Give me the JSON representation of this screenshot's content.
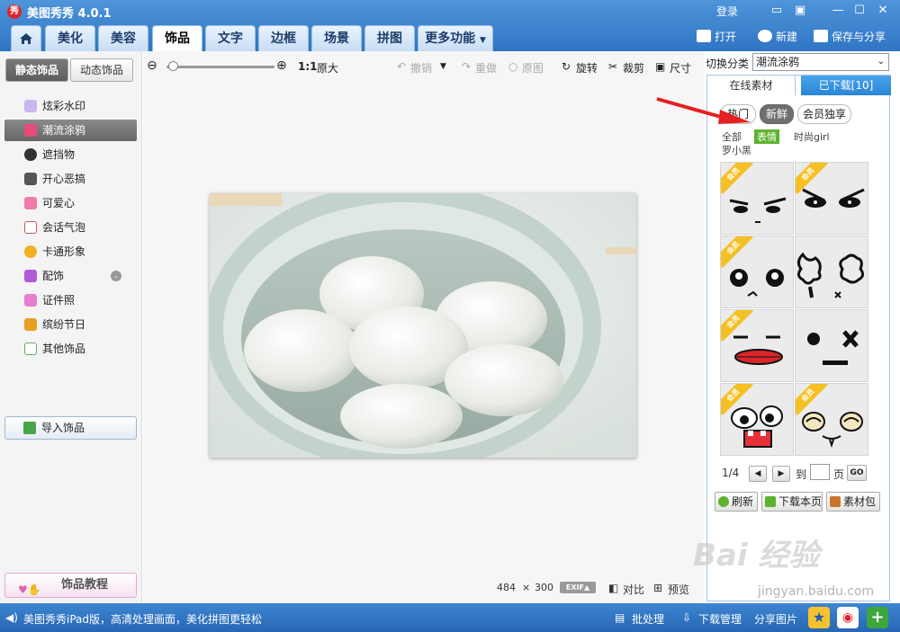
{
  "app": {
    "title": "美图秀秀 4.0.1",
    "logo_text": "秀",
    "login": "登录",
    "window_controls": [
      "chat-icon",
      "skin-icon",
      "minimize-icon",
      "maximize-icon",
      "close-icon"
    ]
  },
  "main_tabs": [
    "美化",
    "美容",
    "饰品",
    "文字",
    "边框",
    "场景",
    "拼图",
    "更多功能"
  ],
  "main_tab_active": "饰品",
  "top_actions": {
    "open": "打开",
    "new": "新建",
    "save_share": "保存与分享"
  },
  "left": {
    "subtabs": [
      "静态饰品",
      "动态饰品"
    ],
    "categories": [
      "炫彩水印",
      "潮流涂鸦",
      "遮挡物",
      "开心恶搞",
      "可爱心",
      "会话气泡",
      "卡通形象",
      "配饰",
      "证件照",
      "缤纷节日",
      "其他饰品"
    ],
    "category_icons": [
      "sparkle-icon",
      "lips-icon",
      "block-icon",
      "gao-icon",
      "heart-icon",
      "bubble-icon",
      "cartoon-icon",
      "bow-icon",
      "shirt-icon",
      "gift-icon",
      "star-icon"
    ],
    "active_category": "潮流涂鸦",
    "import_label": "导入饰品",
    "tutorial_label": "饰品教程"
  },
  "toolbar": {
    "ratio": "1:1",
    "original_size": "原大",
    "undo": "撤销",
    "redo": "重做",
    "original": "原图",
    "rotate": "旋转",
    "crop": "裁剪",
    "resize": "尺寸"
  },
  "canvas_info": {
    "width": "484",
    "times": "×",
    "height": "300",
    "exif": "EXIF",
    "compare": "对比",
    "preview": "预览"
  },
  "right": {
    "switch_label": "切换分类",
    "switch_value": "潮流涂鸦",
    "tabs": [
      "在线素材",
      "已下载[10]"
    ],
    "filters": [
      "热门",
      "新鲜",
      "会员独享"
    ],
    "active_filter": "新鲜",
    "subfilters": [
      "全部",
      "表情",
      "时尚girl",
      "罗小黑"
    ],
    "active_subfilter": "表情",
    "member_badge": "会员",
    "pager": {
      "page": "1/4",
      "goto": "到",
      "page_unit": "页",
      "go": "GO"
    },
    "buttons": [
      "刷新",
      "下载本页",
      "素材包"
    ]
  },
  "watermark": {
    "brand": "Bai 经验",
    "url": "jingyan.baidu.com"
  },
  "status": {
    "message": "美图秀秀iPad版，高清处理画面，美化拼图更轻松",
    "batch": "批处理",
    "download_manager": "下载管理",
    "share_image": "分享图片"
  },
  "colors": {
    "accent_blue": "#2f75c4",
    "active_green": "#5db22e",
    "member_gold": "#f5c023"
  }
}
